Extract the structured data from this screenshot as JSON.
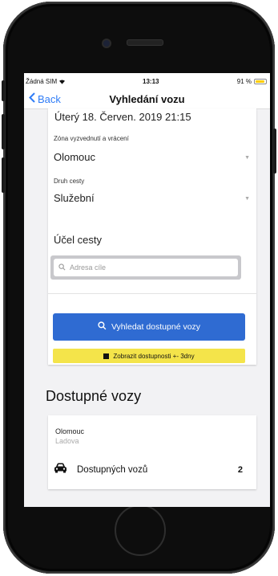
{
  "status_bar": {
    "carrier": "Žádná SIM",
    "time": "13:13",
    "battery": "91 %"
  },
  "nav": {
    "back_label": "Back",
    "title": "Vyhledání vozu"
  },
  "form": {
    "datetime": "Úterý 18. Červen. 2019 21:15",
    "zone_label": "Zóna vyzvednutí a vrácení",
    "zone_value": "Olomouc",
    "trip_type_label": "Druh cesty",
    "trip_type_value": "Služební",
    "purpose_label": "Účel cesty",
    "search_placeholder": "Adresa cíle"
  },
  "buttons": {
    "search_label": "Vyhledat dostupné vozy",
    "availability_label": "Zobrazit dostupnosti +- 3dny"
  },
  "results": {
    "section_title": "Dostupné vozy",
    "location_title": "Olomouc",
    "location_subtitle": "Ladova",
    "available_label": "Dostupných vozů",
    "available_count": "2"
  },
  "colors": {
    "accent": "#2f6bd2",
    "link": "#2f7cf6",
    "highlight": "#f4e44a",
    "battery": "#ffcc00"
  },
  "icons": [
    "chevron-left-icon",
    "wifi-icon",
    "battery-icon",
    "chevron-down-icon",
    "search-icon",
    "calendar-icon",
    "car-icon"
  ]
}
